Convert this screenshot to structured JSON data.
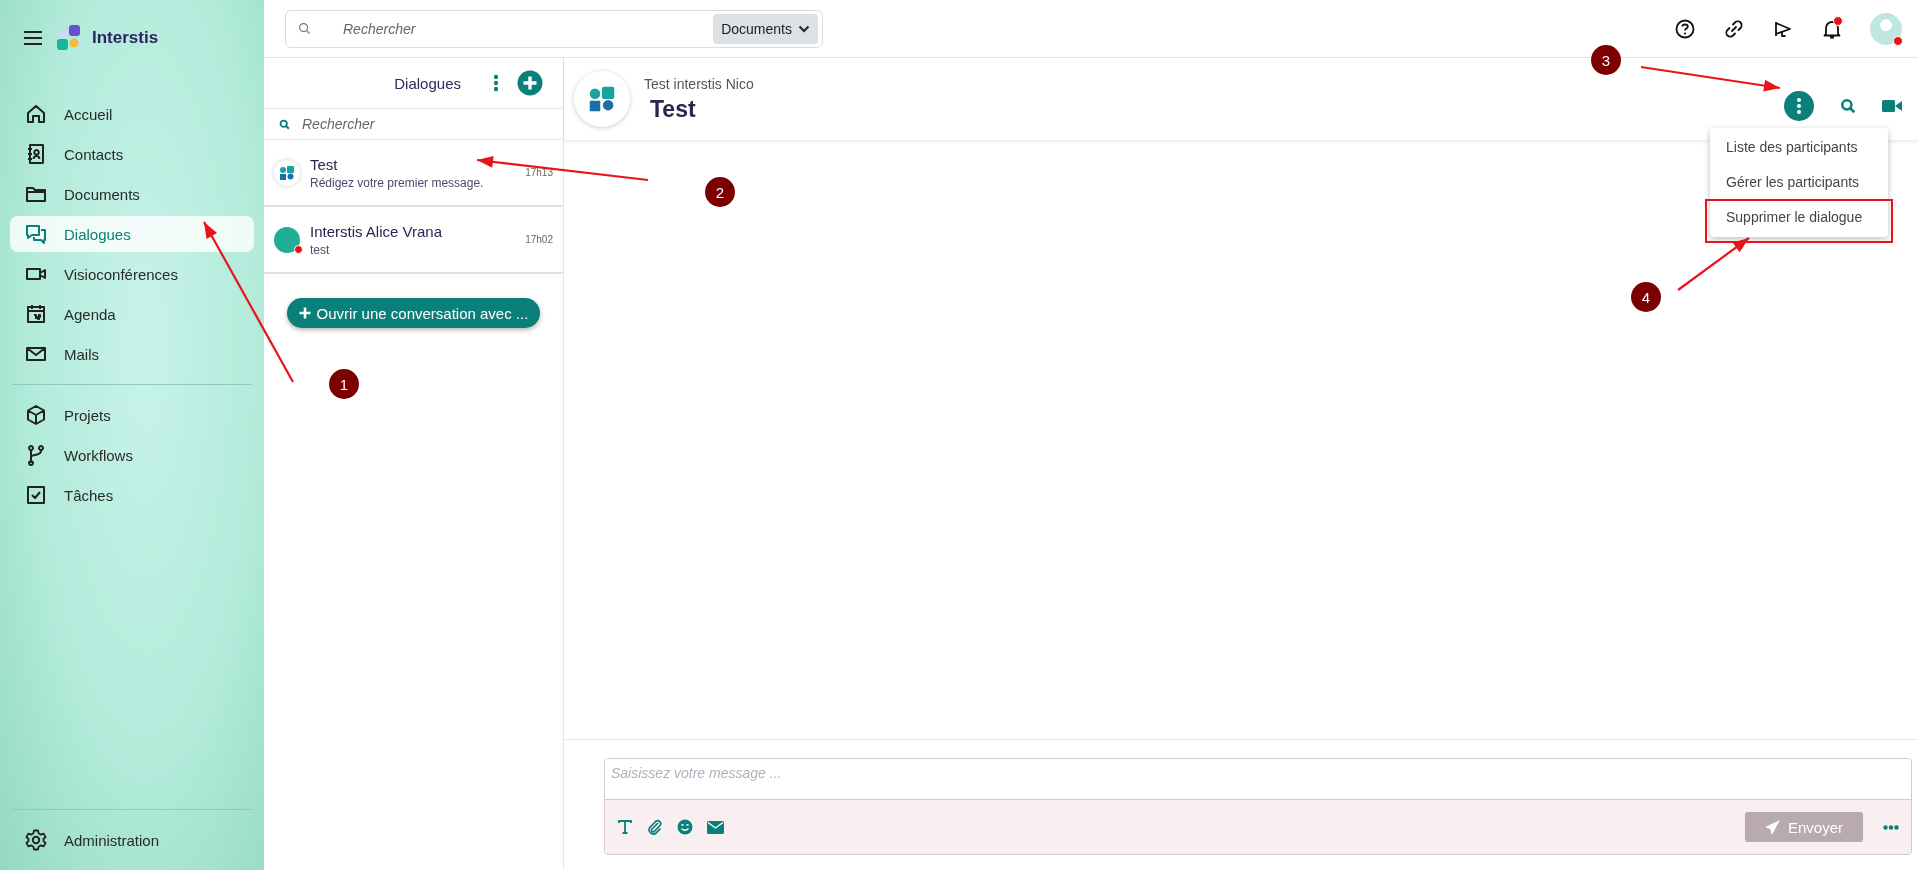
{
  "brand": {
    "name": "Interstis"
  },
  "sidebar": {
    "sections": [
      {
        "items": [
          {
            "label": "Accueil",
            "selected": false
          },
          {
            "label": "Contacts",
            "selected": false
          },
          {
            "label": "Documents",
            "selected": false
          },
          {
            "label": "Dialogues",
            "selected": true
          },
          {
            "label": "Visioconférences",
            "selected": false
          },
          {
            "label": "Agenda",
            "selected": false
          },
          {
            "label": "Mails",
            "selected": false
          }
        ]
      },
      {
        "items": [
          {
            "label": "Projets",
            "selected": false
          },
          {
            "label": "Workflows",
            "selected": false
          },
          {
            "label": "Tâches",
            "selected": false
          }
        ]
      }
    ],
    "footer": {
      "label": "Administration",
      "selected": false
    }
  },
  "topbar": {
    "search": {
      "placeholder": "Rechercher",
      "scope": "Documents"
    },
    "notifications": {
      "unread": true
    },
    "user": {
      "status_dot": true
    }
  },
  "dialogues": {
    "title": "Dialogues",
    "search": {
      "placeholder": "Rechercher"
    },
    "conversations": [
      {
        "kind": "group",
        "name": "Test",
        "preview": "Rédigez votre premier message.",
        "time": "17h13",
        "status_dot": false
      },
      {
        "kind": "person",
        "name": "Interstis Alice Vrana",
        "preview": "test",
        "time": "17h02",
        "status_dot": true
      }
    ],
    "open_button": "Ouvrir une conversation avec ..."
  },
  "chat": {
    "subtitle": "Test interstis Nico",
    "title": "Test",
    "menu": [
      {
        "label": "Liste des participants",
        "highlighted": false
      },
      {
        "label": "Gérer les participants",
        "highlighted": false
      },
      {
        "label": "Supprimer le dialogue",
        "highlighted": true
      }
    ],
    "composer": {
      "placeholder": "Saisissez votre message ...",
      "send": "Envoyer",
      "send_disabled": true
    }
  },
  "annotations": [
    {
      "label": "1"
    },
    {
      "label": "2"
    },
    {
      "label": "3"
    },
    {
      "label": "4"
    }
  ]
}
